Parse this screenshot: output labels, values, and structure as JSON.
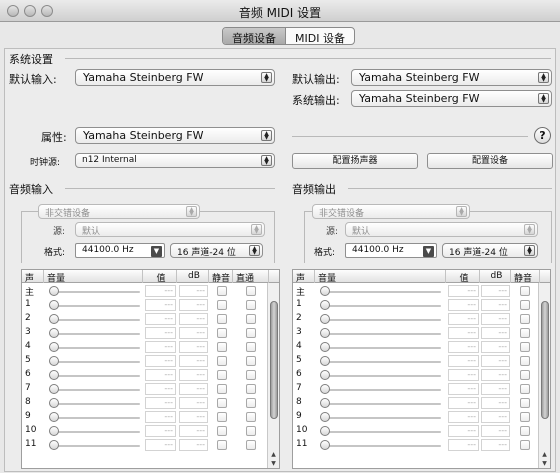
{
  "window": {
    "title": "音频 MIDI 设置"
  },
  "tabs": [
    {
      "label": "音频设备",
      "selected": true
    },
    {
      "label": "MIDI 设备",
      "selected": false
    }
  ],
  "system": {
    "section_label": "系统设置",
    "default_input_label": "默认输入:",
    "default_input_value": "Yamaha Steinberg FW",
    "default_output_label": "默认输出:",
    "default_output_value": "Yamaha Steinberg FW",
    "system_output_label": "系统输出:",
    "system_output_value": "Yamaha Steinberg FW"
  },
  "properties": {
    "label": "属性:",
    "device_value": "Yamaha Steinberg FW",
    "help": "?",
    "clock_label": "时钟源:",
    "clock_value": "n12 Internal",
    "configure_speakers": "配置扬声器",
    "configure_device": "配置设备"
  },
  "audio_input": {
    "section_label": "音频输入",
    "stream_value": "非交错设备",
    "source_label": "源:",
    "source_value": "默认",
    "format_label": "格式:",
    "rate_value": "44100.0 Hz",
    "channels_value": "16 声道-24 位",
    "columns": [
      "声",
      "音量",
      "值",
      "dB",
      "静音",
      "直通"
    ],
    "channels": [
      "主",
      "1",
      "2",
      "3",
      "4",
      "5",
      "6",
      "7",
      "8",
      "9",
      "10",
      "11"
    ],
    "placeholder": "---"
  },
  "audio_output": {
    "section_label": "音频输出",
    "stream_value": "非交错设备",
    "source_label": "源:",
    "source_value": "默认",
    "format_label": "格式:",
    "rate_value": "44100.0 Hz",
    "channels_value": "16 声道-24 位",
    "columns": [
      "声",
      "音量",
      "值",
      "dB",
      "静音"
    ],
    "channels": [
      "主",
      "1",
      "2",
      "3",
      "4",
      "5",
      "6",
      "7",
      "8",
      "9",
      "10",
      "11"
    ],
    "placeholder": "---"
  },
  "icons": {
    "popup": "up-down-arrows-icon",
    "dropdown": "down-arrow-icon",
    "scroll_up": "scroll-up-arrow-icon",
    "scroll_down": "scroll-down-arrow-icon"
  }
}
